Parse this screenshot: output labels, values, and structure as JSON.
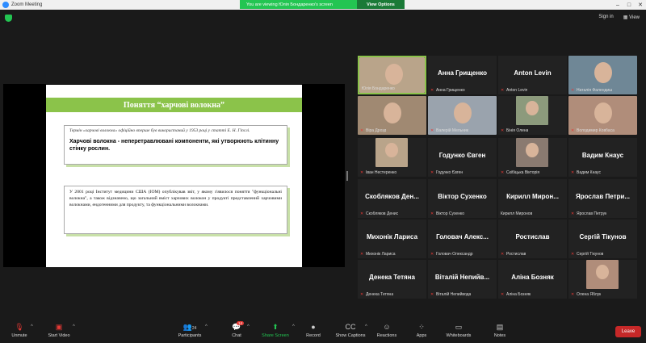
{
  "window": {
    "title": "Zoom Meeting"
  },
  "banner": {
    "message": "You are viewing Юлія Бондаренко's screen",
    "options_label": "View Options"
  },
  "topright": {
    "signin": "Sign in",
    "view": "View"
  },
  "slide": {
    "title": "Поняття “харчові волокна”",
    "box1_italic": "Термін «харчові волокна» офіційно вперше був використаний у 1953 році у статті Е. Н. Гіпслі.",
    "box1_bold": "Харчові волокна - неперетравлювані компоненти, які утворюють клітинну стінку рослин.",
    "box2_text": "У 2001 році Інститут медицини США (IOM) опублікував звіт, у якому з'явилося поняття \"функціональні волокна\", а також відзначено, що загальний вміст харчових волокон у продукті представлений харчовими волокнами, ендогенними для продукту, та функціональними волокнами."
  },
  "participants": [
    {
      "label": "Юлія Бондаренко",
      "big": "",
      "video": true,
      "muted": false
    },
    {
      "label": "Анна Грищенко",
      "big": "Анна Грищенко",
      "video": false,
      "muted": true
    },
    {
      "label": "Anton Levin",
      "big": "Anton Levin",
      "video": false,
      "muted": true
    },
    {
      "label": "Наталія Фалендиш",
      "big": "",
      "video": true,
      "muted": true
    },
    {
      "label": "Віра Дрозд",
      "big": "",
      "video": true,
      "muted": true
    },
    {
      "label": "Валерій Мельник",
      "big": "",
      "video": true,
      "muted": true
    },
    {
      "label": "Бінія Олена",
      "big": "",
      "video": true,
      "muted": true
    },
    {
      "label": "Володимир Ковбаса",
      "big": "",
      "video": true,
      "muted": true
    },
    {
      "label": "Іван Нестеренко",
      "big": "",
      "video": true,
      "muted": true
    },
    {
      "label": "Годунко Євген",
      "big": "Годунко Євген",
      "video": false,
      "muted": true
    },
    {
      "label": "Скібіцька Вікторія",
      "big": "",
      "video": true,
      "muted": true
    },
    {
      "label": "Вадим Кнаус",
      "big": "Вадим Кнаус",
      "video": false,
      "muted": true
    },
    {
      "label": "Скобляков Денис",
      "big": "Скобляков Ден...",
      "video": false,
      "muted": true
    },
    {
      "label": "Віктор Сухенко",
      "big": "Віктор Сухенко",
      "video": false,
      "muted": true
    },
    {
      "label": "Кирилл Миронов",
      "big": "Кирилл Мирон...",
      "video": false,
      "muted": false
    },
    {
      "label": "Ярослав Петрук",
      "big": "Ярослав Петри...",
      "video": false,
      "muted": true
    },
    {
      "label": "Михонік Лариса",
      "big": "Михонік Лариса",
      "video": false,
      "muted": true
    },
    {
      "label": "Головач Олександр",
      "big": "Головач Алекс...",
      "video": false,
      "muted": true
    },
    {
      "label": "Ростислав",
      "big": "Ростислав",
      "video": false,
      "muted": true
    },
    {
      "label": "Сергій Тікунов",
      "big": "Сергій Тікунов",
      "video": false,
      "muted": true
    },
    {
      "label": "Денека Тетяна",
      "big": "Денека Тетяна",
      "video": false,
      "muted": true
    },
    {
      "label": "Віталій Непийвода",
      "big": "Віталій Непийв...",
      "video": false,
      "muted": true
    },
    {
      "label": "Аліна Бозняк",
      "big": "Аліна Бозняк",
      "video": false,
      "muted": true
    },
    {
      "label": "Олена Яблук",
      "big": "",
      "video": true,
      "muted": true
    }
  ],
  "toolbar": {
    "unmute": "Unmute",
    "start_video": "Start Video",
    "participants": "Participants",
    "participants_count": "24",
    "chat": "Chat",
    "chat_badge": "14",
    "share_screen": "Share Screen",
    "record": "Record",
    "show_captions": "Show Captions",
    "reactions": "Reactions",
    "apps": "Apps",
    "whiteboards": "Whiteboards",
    "notes": "Notes",
    "leave": "Leave"
  }
}
